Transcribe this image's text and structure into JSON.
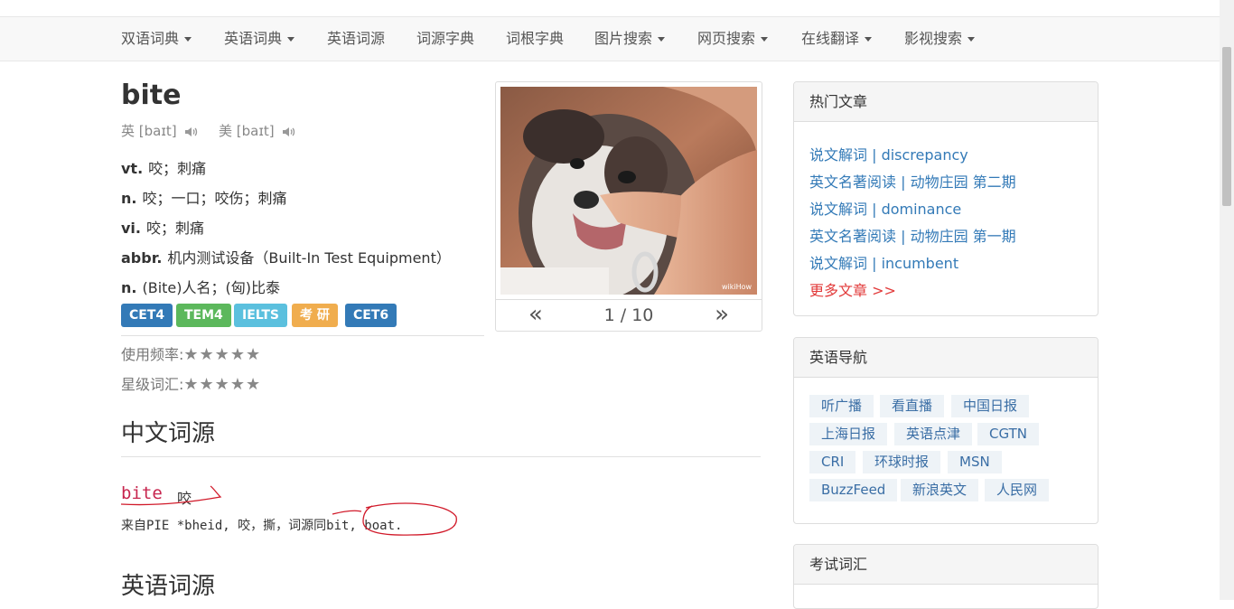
{
  "nav": {
    "items": [
      {
        "label": "双语词典",
        "dropdown": true
      },
      {
        "label": "英语词典",
        "dropdown": true
      },
      {
        "label": "英语词源",
        "dropdown": false
      },
      {
        "label": "词源字典",
        "dropdown": false
      },
      {
        "label": "词根字典",
        "dropdown": false
      },
      {
        "label": "图片搜索",
        "dropdown": true
      },
      {
        "label": "网页搜索",
        "dropdown": true
      },
      {
        "label": "在线翻译",
        "dropdown": true
      },
      {
        "label": "影视搜索",
        "dropdown": true
      }
    ]
  },
  "entry": {
    "word": "bite",
    "phonetic_uk": "英 [baɪt]",
    "phonetic_us": "美 [baɪt]",
    "definitions": [
      {
        "pos": "vt.",
        "text": "咬；刺痛"
      },
      {
        "pos": "n.",
        "text": "咬；一口；咬伤；刺痛"
      },
      {
        "pos": "vi.",
        "text": "咬；刺痛"
      },
      {
        "pos": "abbr.",
        "text": "机内测试设备（Built-In Test Equipment）"
      },
      {
        "pos": "n.",
        "text": "(Bite)人名；(匈)比泰"
      }
    ],
    "tags": [
      {
        "label": "CET4",
        "color": "#337ab7"
      },
      {
        "label": "TEM4",
        "color": "#5cb85c"
      },
      {
        "label": "IELTS",
        "color": "#5bc0de"
      },
      {
        "label": "考 研",
        "color": "#f0ad4e"
      },
      {
        "label": "CET6",
        "color": "#337ab7"
      }
    ],
    "frequency_label": "使用频率:",
    "frequency_stars": "★★★★★",
    "star_label": "星级词汇:",
    "star_stars": "★★★★★"
  },
  "carousel": {
    "counter": "1 / 10",
    "prev": "«",
    "next": "»",
    "watermark": "wikiHow"
  },
  "etymology": {
    "chinese_heading": "中文词源",
    "word": "bite",
    "meaning": "咬",
    "text": "来自PIE *bheid, 咬，撕，词源同bit, boat.",
    "english_heading": "英语词源"
  },
  "sidebar": {
    "hot_title": "热门文章",
    "articles": [
      "说文解词 | discrepancy",
      "英文名著阅读 | 动物庄园 第二期",
      "说文解词 | dominance",
      "英文名著阅读 | 动物庄园 第一期",
      "说文解词 | incumbent"
    ],
    "more": "更多文章 >>",
    "nav_title": "英语导航",
    "nav_links": [
      "听广播",
      "看直播",
      "中国日报",
      "上海日报",
      "英语点津",
      "CGTN",
      "CRI",
      "环球时报",
      "MSN",
      "BuzzFeed",
      "新浪英文",
      "人民网"
    ],
    "exam_title": "考试词汇"
  }
}
